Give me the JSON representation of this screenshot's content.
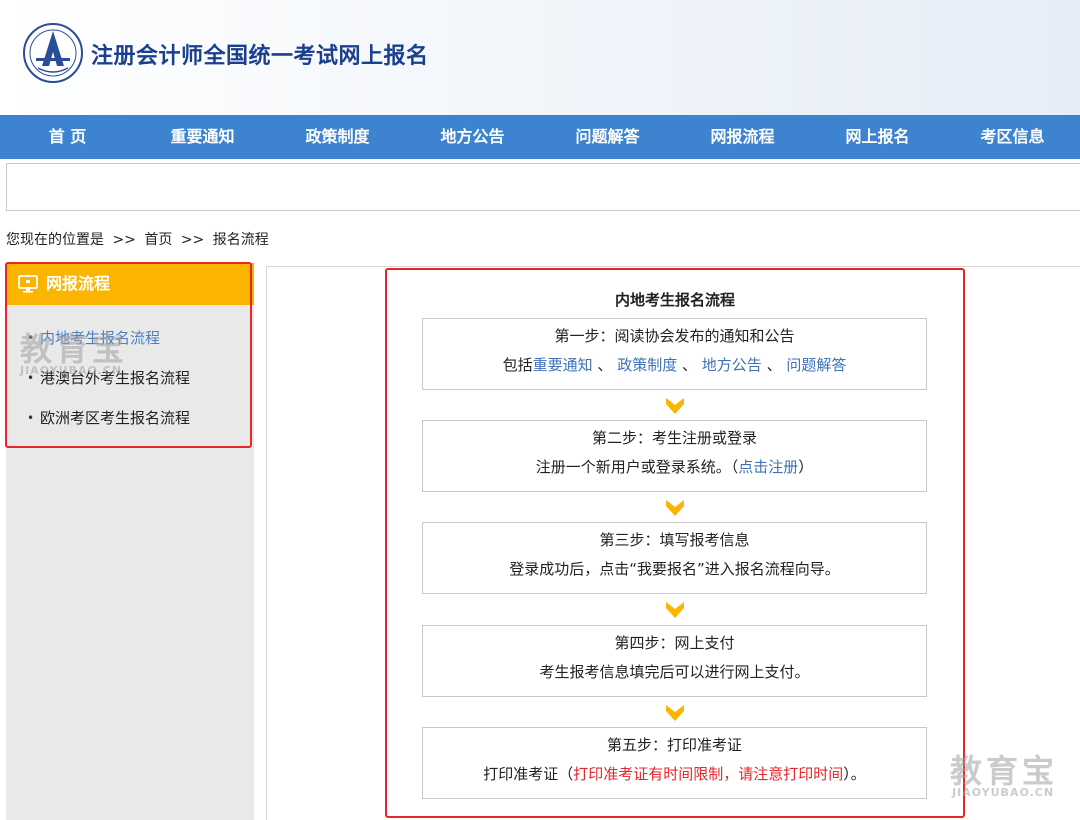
{
  "header": {
    "title": "注册会计师全国统一考试网上报名"
  },
  "nav": {
    "items": [
      "首 页",
      "重要通知",
      "政策制度",
      "地方公告",
      "问题解答",
      "网报流程",
      "网上报名",
      "考区信息"
    ]
  },
  "breadcrumb": {
    "prefix": "您现在的位置是",
    "sep1": ">>",
    "home": "首页",
    "sep2": ">>",
    "current": "报名流程"
  },
  "sidebar": {
    "header": "网报流程",
    "items": [
      {
        "label": "内地考生报名流程",
        "active": true
      },
      {
        "label": "港澳台外考生报名流程",
        "active": false
      },
      {
        "label": "欧洲考区考生报名流程",
        "active": false
      }
    ]
  },
  "flow": {
    "title": "内地考生报名流程",
    "step1": {
      "title": "第一步：阅读协会发布的通知和公告",
      "prefix": "包括",
      "link1": "重要通知",
      "sep1": " 、",
      "link2": "政策制度",
      "sep2": " 、",
      "link3": "地方公告",
      "sep3": " 、",
      "link4": "问题解答"
    },
    "step2": {
      "title": "第二步：考生注册或登录",
      "desc": "注册一个新用户或登录系统。（",
      "link": "点击注册",
      "suffix": "）"
    },
    "step3": {
      "title": "第三步：填写报考信息",
      "desc": "登录成功后，点击“我要报名”进入报名流程向导。"
    },
    "step4": {
      "title": "第四步：网上支付",
      "desc": "考生报考信息填完后可以进行网上支付。"
    },
    "step5": {
      "title": "第五步：打印准考证",
      "prefix": "打印准考证（",
      "warning": "打印准考证有时间限制，请注意打印时间",
      "suffix": "）。"
    }
  },
  "watermark": {
    "big": "教育宝",
    "small": "JIAOYUBAO.CN"
  },
  "colors": {
    "nav": "#3e83cf",
    "sidebar_header": "#fbb400",
    "link": "#3f72b6",
    "warning": "#e8252b",
    "arrow": "#fbb400"
  }
}
